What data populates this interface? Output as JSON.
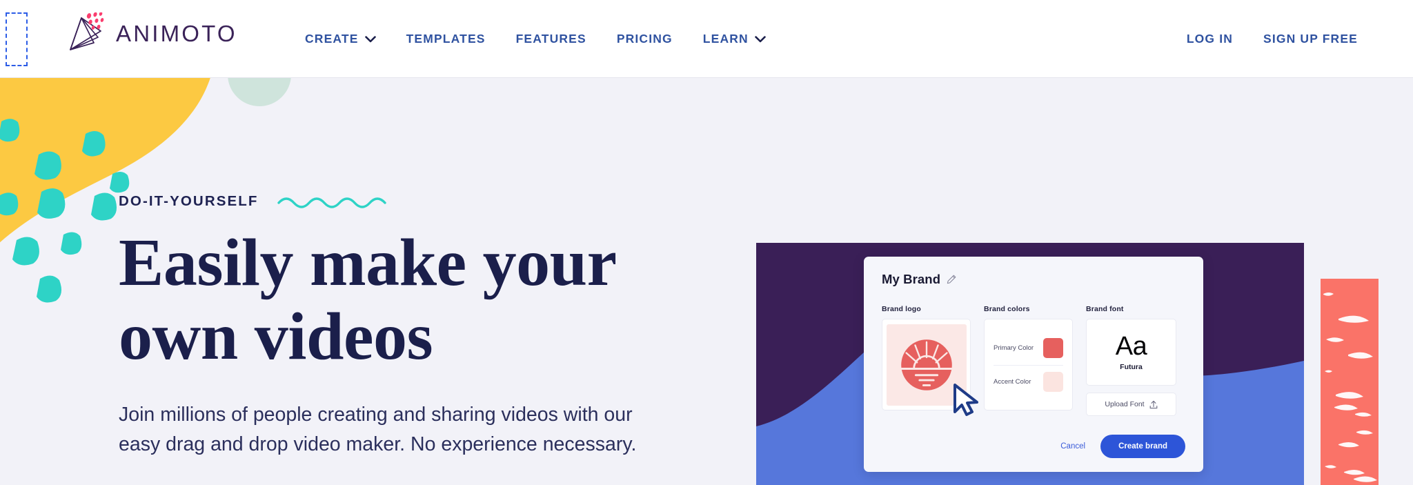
{
  "colors": {
    "page_background": "#F2F2F8",
    "nav_blue": "#2F52A0",
    "heading_navy": "#1B1F4B",
    "accent_teal": "#2ED3C6",
    "accent_yellow": "#FCC942",
    "accent_mint": "#CFE4DC",
    "panel_purple": "#3A1F57",
    "panel_blue": "#5677DB",
    "panel_coral": "#FA7368",
    "button_blue": "#2D55D8",
    "logo_purple": "#3A2258",
    "logo_pink": "#FA3E6E",
    "brand_primary_color": "#E6605E",
    "brand_accent_color": "#FBE4E0",
    "cursor_blue": "#1F3C88"
  },
  "header": {
    "logo": {
      "wordmark": "ANIMOTO",
      "mark_icon": "animoto-fan-icon"
    },
    "nav_items": [
      {
        "label": "CREATE",
        "has_dropdown": true,
        "icon": "chevron-down-icon"
      },
      {
        "label": "TEMPLATES",
        "has_dropdown": false,
        "icon": ""
      },
      {
        "label": "FEATURES",
        "has_dropdown": false,
        "icon": ""
      },
      {
        "label": "PRICING",
        "has_dropdown": false,
        "icon": ""
      },
      {
        "label": "LEARN",
        "has_dropdown": true,
        "icon": "chevron-down-icon"
      }
    ],
    "auth_items": [
      {
        "label": "LOG IN"
      },
      {
        "label": "SIGN UP FREE"
      }
    ]
  },
  "hero": {
    "eyebrow": "DO-IT-YOURSELF",
    "squiggle_icon": "wavy-line-icon",
    "title": "Easily make your own videos",
    "subtitle": "Join millions of people creating and sharing videos with our easy drag and drop video maker. No experience necessary."
  },
  "product": {
    "modal": {
      "title": "My Brand",
      "edit_icon": "pencil-icon",
      "columns": {
        "logo": {
          "heading": "Brand logo",
          "thumb_icon": "sunrise-logo-icon"
        },
        "colors": {
          "heading": "Brand colors",
          "rows": [
            {
              "label": "Primary Color",
              "swatch": "#E6605E"
            },
            {
              "label": "Accent Color",
              "swatch": "#FBE4E0"
            }
          ]
        },
        "font": {
          "heading": "Brand font",
          "sample": "Aa",
          "name": "Futura",
          "upload_label": "Upload Font",
          "upload_icon": "upload-arrow-icon"
        }
      },
      "cancel_label": "Cancel",
      "submit_label": "Create brand",
      "cursor_icon": "mouse-pointer-icon"
    }
  }
}
